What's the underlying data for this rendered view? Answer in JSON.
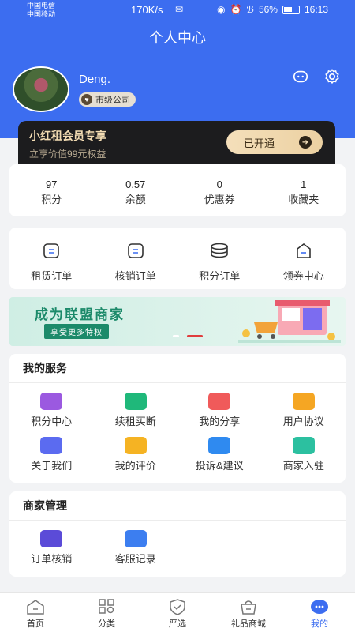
{
  "status_bar": {
    "carrier1": "中国电信",
    "carrier2": "中国移动",
    "speed": "170K/s",
    "battery": "56%",
    "time": "16:13"
  },
  "header": {
    "title": "个人中心"
  },
  "profile": {
    "username": "Deng.",
    "level_badge": "市级公司"
  },
  "vip": {
    "title": "小红租会员专享",
    "subtitle": "立享价值99元权益",
    "button": "已开通"
  },
  "stats": [
    {
      "value": "97",
      "label": "积分"
    },
    {
      "value": "0.57",
      "label": "余额"
    },
    {
      "value": "0",
      "label": "优惠券"
    },
    {
      "value": "1",
      "label": "收藏夹"
    }
  ],
  "orders": [
    {
      "label": "租赁订单",
      "icon": "rent-order-icon"
    },
    {
      "label": "核销订单",
      "icon": "verify-order-icon"
    },
    {
      "label": "积分订单",
      "icon": "points-order-icon"
    },
    {
      "label": "领券中心",
      "icon": "coupon-center-icon"
    }
  ],
  "banner": {
    "title": "成为联盟商家",
    "subtitle": "享受更多特权"
  },
  "services": {
    "title": "我的服务",
    "items": [
      {
        "label": "积分中心",
        "icon": "points-center-icon",
        "color": "#9b59e0"
      },
      {
        "label": "续租买断",
        "icon": "renew-buyout-icon",
        "color": "#1fb87a"
      },
      {
        "label": "我的分享",
        "icon": "share-icon",
        "color": "#f05a5a"
      },
      {
        "label": "用户协议",
        "icon": "agreement-icon",
        "color": "#f5a623"
      },
      {
        "label": "关于我们",
        "icon": "about-icon",
        "color": "#5b6bf0"
      },
      {
        "label": "我的评价",
        "icon": "review-icon",
        "color": "#f5b323"
      },
      {
        "label": "投诉&建议",
        "icon": "complaint-icon",
        "color": "#2f8af0"
      },
      {
        "label": "商家入驻",
        "icon": "merchant-join-icon",
        "color": "#2cc0a0"
      }
    ]
  },
  "merchant": {
    "title": "商家管理",
    "items": [
      {
        "label": "订单核销",
        "icon": "order-verify-icon",
        "color": "#5b4bd8"
      },
      {
        "label": "客服记录",
        "icon": "service-record-icon",
        "color": "#3c7ef0"
      }
    ]
  },
  "tabbar": [
    {
      "label": "首页",
      "icon": "home-icon"
    },
    {
      "label": "分类",
      "icon": "category-icon"
    },
    {
      "label": "严选",
      "icon": "shield-icon"
    },
    {
      "label": "礼品商城",
      "icon": "gift-mall-icon"
    },
    {
      "label": "我的",
      "icon": "profile-icon",
      "active": true
    }
  ],
  "colors": {
    "primary": "#3c6df0",
    "vip_bg": "#1c1c1e",
    "vip_gold": "#f3dcb3"
  }
}
